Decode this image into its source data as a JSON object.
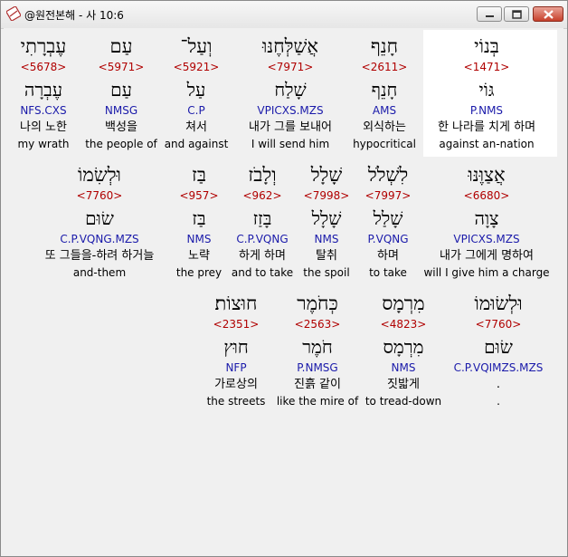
{
  "window": {
    "title": "@원전본해 - 사 10:6",
    "icons": {
      "app": "bible-app-icon",
      "minimize": "minimize-icon",
      "maximize": "maximize-icon",
      "close": "close-icon"
    }
  },
  "rows": [
    [
      {
        "hebrew": "בְּנוֹי",
        "strong": "<1471>",
        "lemma": "גּוֹי",
        "morph": "P.NMS",
        "korean": "한 나라를 치게 하며",
        "english": "against an-nation"
      },
      {
        "hebrew": "חָנֵף",
        "strong": "<2611>",
        "lemma": "חָנֵף",
        "morph": "AMS",
        "korean": "외식하는",
        "english": "hypocritical"
      },
      {
        "hebrew": "אֲשַׁלְּחֶנּוּ",
        "strong": "<7971>",
        "lemma": "שָׁלַח",
        "morph": "VPICXS.MZS",
        "korean": "내가 그를 보내어",
        "english": "I will send him"
      },
      {
        "hebrew": "וְעַל־",
        "strong": "<5921>",
        "lemma": "עַל",
        "morph": "C.P",
        "korean": "쳐서",
        "english": "and against"
      },
      {
        "hebrew": "עַם",
        "strong": "<5971>",
        "lemma": "עַם",
        "morph": "NMSG",
        "korean": "백성을",
        "english": "the people of"
      },
      {
        "hebrew": "עֶבְרָתִי",
        "strong": "<5678>",
        "lemma": "עֶבְרָה",
        "morph": "NFS.CXS",
        "korean": "나의 노한",
        "english": "my wrath"
      }
    ],
    [
      {
        "hebrew": "אֲצַוֶּנּוּ",
        "strong": "<6680>",
        "lemma": "צָוָה",
        "morph": "VPICXS.MZS",
        "korean": "내가 그에게 명하여",
        "english": "will I give him a charge"
      },
      {
        "hebrew": "לִשְׁלֹל",
        "strong": "<7997>",
        "lemma": "שָׁלַל",
        "morph": "P.VQNG",
        "korean": "하며",
        "english": "to take"
      },
      {
        "hebrew": "שָׁלָל",
        "strong": "<7998>",
        "lemma": "שָׁלָל",
        "morph": "NMS",
        "korean": "탈취",
        "english": "the spoil"
      },
      {
        "hebrew": "וְלָבֹז",
        "strong": "<962>",
        "lemma": "בָּזַז",
        "morph": "C.P.VQNG",
        "korean": "하게 하며",
        "english": "and to take"
      },
      {
        "hebrew": "בַּז",
        "strong": "<957>",
        "lemma": "בַּז",
        "morph": "NMS",
        "korean": "노략",
        "english": "the prey"
      },
      {
        "hebrew": "וּלְשִׂמוֹ",
        "strong": "<7760>",
        "lemma": "שׂוּם",
        "morph": "C.P.VQNG.MZS",
        "korean": "또 그들을-하려 하거늘",
        "english": "and-them"
      }
    ],
    [
      {
        "hebrew": "וּלְשׂוּמוֹ",
        "strong": "<7760>",
        "lemma": "שׂוּם",
        "morph": "C.P.VQIMZS.MZS",
        "korean": ".",
        "english": "."
      },
      {
        "hebrew": "מִרְמָס",
        "strong": "<4823>",
        "lemma": "מִרְמָס",
        "morph": "NMS",
        "korean": "짓밟게",
        "english": "to tread-down"
      },
      {
        "hebrew": "כְּחֹמֶר",
        "strong": "<2563>",
        "lemma": "חֹמֶר",
        "morph": "P.NMSG",
        "korean": "진흙 같이",
        "english": "like the mire of"
      },
      {
        "hebrew": "חוּצוֹת׃",
        "strong": "<2351>",
        "lemma": "חוּץ",
        "morph": "NFP",
        "korean": "가로상의",
        "english": "the streets"
      }
    ]
  ]
}
